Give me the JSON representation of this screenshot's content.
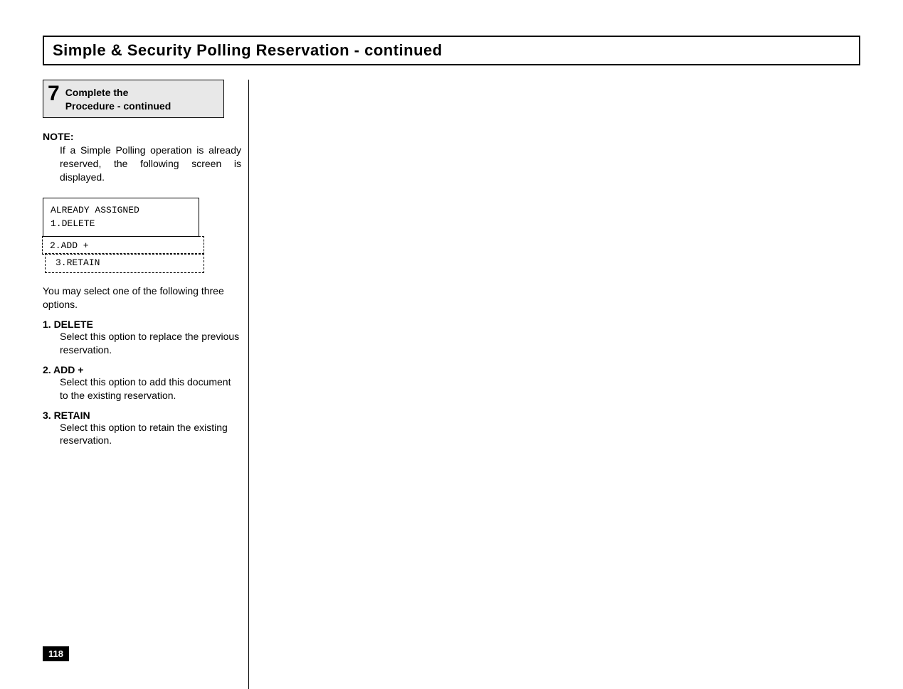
{
  "title": "Simple & Security Polling Reservation - continued",
  "step": {
    "number": "7",
    "line1": "Complete the",
    "line2": "Procedure - continued"
  },
  "note": {
    "label": "NOTE:",
    "body": "If a Simple Polling operation is already reserved, the following screen is displayed."
  },
  "screen": {
    "line1": "ALREADY ASSIGNED",
    "line2": "1.DELETE",
    "line3": "2.ADD +",
    "line4": "3.RETAIN"
  },
  "intro": "You may select one of the following three options.",
  "options": [
    {
      "label": "1. DELETE",
      "body": "Select this option to replace the previous reservation."
    },
    {
      "label": "2. ADD +",
      "body": "Select this option to add this document to the existing reservation."
    },
    {
      "label": "3. RETAIN",
      "body": "Select this option to retain the existing reservation."
    }
  ],
  "pageNumber": "118"
}
